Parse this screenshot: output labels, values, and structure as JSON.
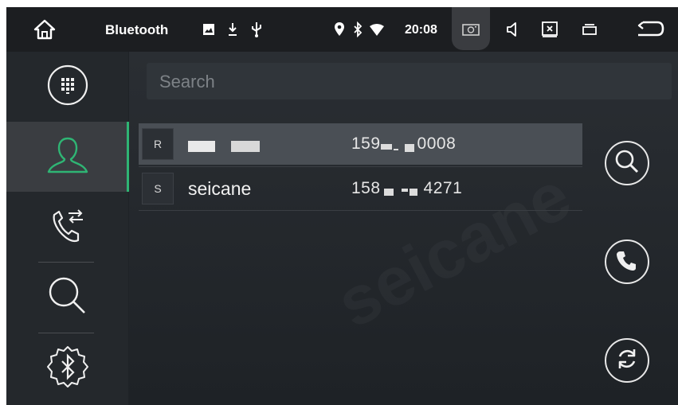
{
  "status_bar": {
    "title": "Bluetooth",
    "time": "20:08",
    "icons": [
      "home-icon",
      "image-icon",
      "download-icon",
      "usb-icon",
      "location-icon",
      "bluetooth-icon",
      "wifi-icon",
      "screenshot-icon",
      "volume-icon",
      "close-window-icon",
      "recent-apps-icon",
      "back-icon"
    ]
  },
  "sidebar": {
    "items": [
      {
        "name": "dialpad",
        "icon": "dialpad-icon"
      },
      {
        "name": "contacts",
        "icon": "contact-icon",
        "active": true
      },
      {
        "name": "call-log",
        "icon": "call-transfer-icon"
      },
      {
        "name": "search",
        "icon": "search-icon"
      },
      {
        "name": "bluetooth-settings",
        "icon": "bluetooth-gear-icon"
      }
    ]
  },
  "search": {
    "placeholder": "Search"
  },
  "contacts": [
    {
      "letter": "R",
      "name": "",
      "number_start": "159",
      "number_end": "0008",
      "selected": true
    },
    {
      "letter": "S",
      "name": "seicane",
      "number_start": "158",
      "number_end": "4271",
      "selected": false
    }
  ],
  "actions": [
    {
      "name": "search",
      "icon": "search-icon"
    },
    {
      "name": "call",
      "icon": "phone-icon"
    },
    {
      "name": "sync",
      "icon": "refresh-icon"
    }
  ],
  "watermark": "seicane",
  "colors": {
    "accent": "#2fb574",
    "background": "#1f2327"
  }
}
